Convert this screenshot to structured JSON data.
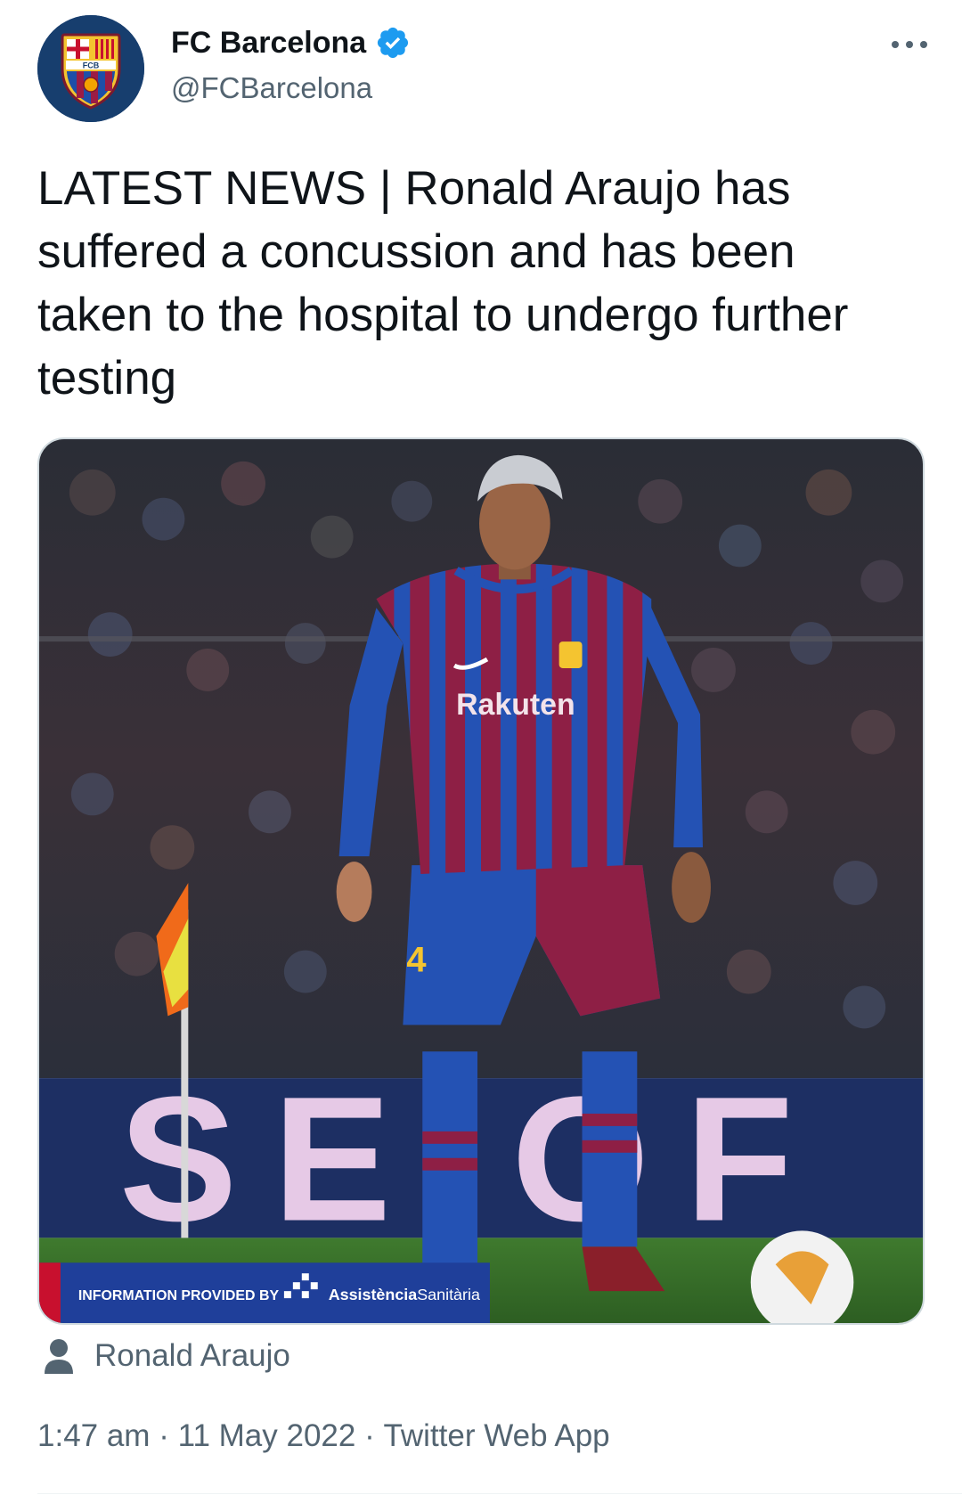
{
  "account": {
    "display_name": "FC Barcelona",
    "handle": "@FCBarcelona",
    "verified": true,
    "avatar_crest_text": "FCB",
    "verified_color": "#1d9bf0"
  },
  "tweet": {
    "text": "LATEST NEWS | Ronald Araujo has suffered a concussion and has been taken to the hospital to undergo further testing"
  },
  "media": {
    "banner_text": "INFORMATION PROVIDED BY",
    "banner_brand_bold": "Assistència",
    "banner_brand_light": "Sanitària",
    "sponsor_text": "Rakuten",
    "shirt_number": "4",
    "board_text": "SE OF"
  },
  "tagged": {
    "icon": "person-icon",
    "name": "Ronald Araujo"
  },
  "meta": {
    "time": "1:47 am",
    "separator": " · ",
    "date": "11 May 2022",
    "source": "Twitter Web App"
  },
  "colors": {
    "text_primary": "#0f1419",
    "text_secondary": "#536471",
    "border": "#cfd9de",
    "barca_blue": "#1d4fa8",
    "barca_red": "#9b1c45"
  }
}
